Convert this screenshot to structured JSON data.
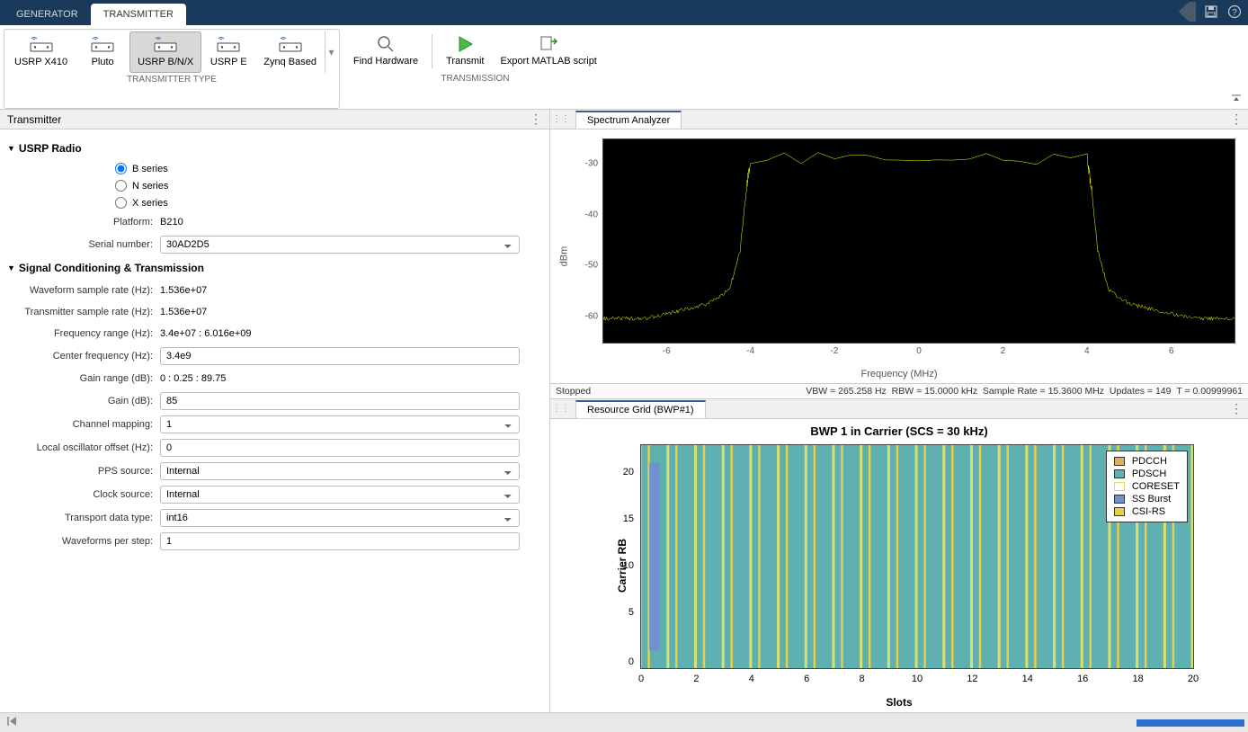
{
  "tabs": {
    "generator": "GENERATOR",
    "transmitter": "TRANSMITTER"
  },
  "ribbon": {
    "transmitter_type_label": "TRANSMITTER TYPE",
    "transmission_label": "TRANSMISSION",
    "buttons": {
      "usrp_x410": "USRP X410",
      "pluto": "Pluto",
      "usrp_bnx": "USRP B/N/X",
      "usrp_e": "USRP E",
      "zynq": "Zynq Based",
      "find_hw": "Find Hardware",
      "transmit": "Transmit",
      "export": "Export MATLAB script"
    }
  },
  "left": {
    "title": "Transmitter",
    "section_radio": "USRP Radio",
    "radios": {
      "b": "B series",
      "n": "N series",
      "x": "X series"
    },
    "platform_label": "Platform:",
    "platform_value": "B210",
    "serial_label": "Serial number:",
    "serial_value": "30AD2D5",
    "section_signal": "Signal Conditioning & Transmission",
    "wfs_label": "Waveform sample rate (Hz):",
    "wfs_value": "1.536e+07",
    "txs_label": "Transmitter sample rate (Hz):",
    "txs_value": "1.536e+07",
    "freqrange_label": "Frequency range (Hz):",
    "freqrange_value": "3.4e+07  :  6.016e+09",
    "cfreq_label": "Center frequency (Hz):",
    "cfreq_value": "3.4e9",
    "gainrange_label": "Gain range (dB):",
    "gainrange_value": "0 : 0.25 : 89.75",
    "gain_label": "Gain (dB):",
    "gain_value": "85",
    "chmap_label": "Channel mapping:",
    "chmap_value": "1",
    "lo_label": "Local oscillator offset (Hz):",
    "lo_value": "0",
    "pps_label": "PPS source:",
    "pps_value": "Internal",
    "clk_label": "Clock source:",
    "clk_value": "Internal",
    "tdt_label": "Transport data type:",
    "tdt_value": "int16",
    "wps_label": "Waveforms per step:",
    "wps_value": "1"
  },
  "spectrum": {
    "tab": "Spectrum Analyzer",
    "ylabel": "dBm",
    "xlabel": "Frequency (MHz)",
    "yticks": [
      "-30",
      "-40",
      "-50",
      "-60"
    ],
    "xticks": [
      "-6",
      "-4",
      "-2",
      "0",
      "2",
      "4",
      "6"
    ],
    "status": {
      "stopped": "Stopped",
      "vbw": "VBW = 265.258 Hz",
      "rbw": "RBW = 15.0000 kHz",
      "sr": "Sample Rate = 15.3600 MHz",
      "updates": "Updates = 149",
      "t": "T = 0.00999961"
    }
  },
  "resource": {
    "tab": "Resource Grid (BWP#1)",
    "title": "BWP 1 in Carrier (SCS = 30 kHz)",
    "ylabel": "Carrier RB",
    "xlabel": "Slots",
    "yticks": [
      "0",
      "5",
      "10",
      "15",
      "20"
    ],
    "xticks": [
      "0",
      "2",
      "4",
      "6",
      "8",
      "10",
      "12",
      "14",
      "16",
      "18",
      "20"
    ],
    "legend": {
      "pdcch": "PDCCH",
      "pdsch": "PDSCH",
      "coreset": "CORESET",
      "ssburst": "SS Burst",
      "csirs": "CSI-RS"
    },
    "colors": {
      "pdcch": "#d9b060",
      "pdsch": "#5fb0b0",
      "coreset": "#d9e070",
      "ssburst": "#7090d0",
      "csirs": "#e8d04a"
    }
  },
  "chart_data": [
    {
      "type": "line",
      "name": "spectrum",
      "title": "Spectrum Analyzer",
      "xlabel": "Frequency (MHz)",
      "ylabel": "dBm",
      "xlim": [
        -7.5,
        7.5
      ],
      "ylim": [
        -67,
        -25
      ],
      "series": [
        {
          "name": "spectrum",
          "color": "#ffff00",
          "x": [
            -7.5,
            -7,
            -6.5,
            -6,
            -5.5,
            -5,
            -4.5,
            -4.25,
            -4.1,
            -4,
            4,
            4.1,
            4.25,
            4.5,
            5,
            5.5,
            6,
            6.5,
            7,
            7.5
          ],
          "y": [
            -62,
            -62,
            -62,
            -61,
            -60,
            -59,
            -56,
            -48,
            -35,
            -29,
            -29,
            -35,
            -48,
            -56,
            -59,
            -60,
            -61,
            -62,
            -62,
            -62
          ]
        }
      ]
    },
    {
      "type": "heatmap",
      "name": "resource-grid",
      "title": "BWP 1 in Carrier (SCS = 30 kHz)",
      "xlabel": "Slots",
      "ylabel": "Carrier RB",
      "xlim": [
        0,
        20
      ],
      "ylim": [
        0,
        24
      ],
      "legend": [
        "PDCCH",
        "PDSCH",
        "CORESET",
        "SS Burst",
        "CSI-RS"
      ],
      "note": "Background PDSCH fill; SS Burst column near slot 0; vertical CORESET/CSI-RS stripes roughly every slot"
    }
  ]
}
